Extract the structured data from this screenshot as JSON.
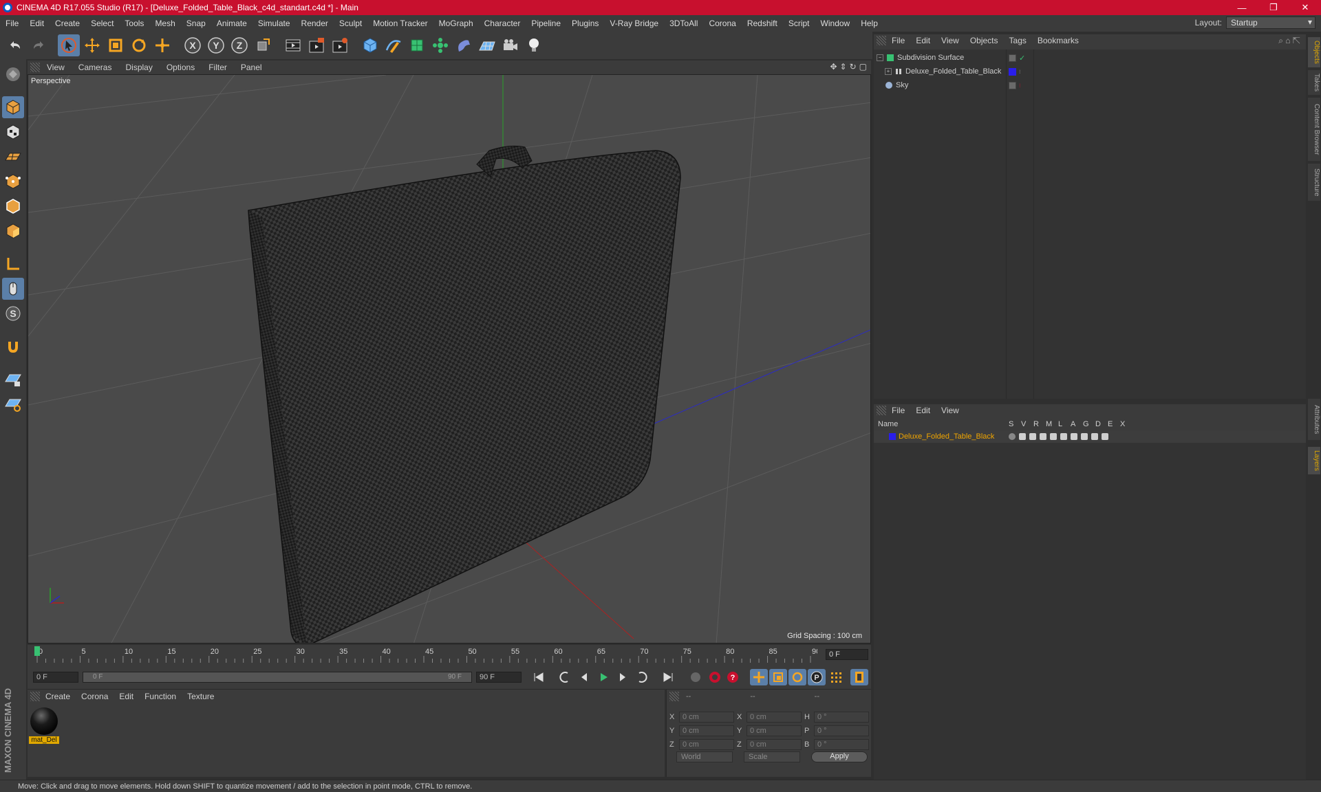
{
  "window": {
    "title": "CINEMA 4D R17.055 Studio (R17) - [Deluxe_Folded_Table_Black_c4d_standart.c4d *] - Main",
    "minimize": "—",
    "maximize": "❐",
    "close": "✕"
  },
  "menu": [
    "File",
    "Edit",
    "Create",
    "Select",
    "Tools",
    "Mesh",
    "Snap",
    "Animate",
    "Simulate",
    "Render",
    "Sculpt",
    "Motion Tracker",
    "MoGraph",
    "Character",
    "Pipeline",
    "Plugins",
    "V-Ray Bridge",
    "3DToAll",
    "Corona",
    "Redshift",
    "Script",
    "Window",
    "Help"
  ],
  "layout": {
    "label": "Layout:",
    "value": "Startup"
  },
  "toolbar": {
    "icons": [
      "undo-icon",
      "redo-icon",
      "select-arrow-icon",
      "move-icon",
      "scale-icon",
      "rotate-icon",
      "live-select-icon",
      "x-axis-icon",
      "y-axis-icon",
      "z-axis-icon",
      "coordinate-system-icon",
      "render-view-icon",
      "render-picture-viewer-icon",
      "edit-render-settings-icon",
      "cube-icon",
      "pen-spline-icon",
      "subdivision-icon",
      "array-icon",
      "deformer-icon",
      "floor-icon",
      "camera-icon",
      "light-icon"
    ]
  },
  "viewport": {
    "menu": [
      "View",
      "Cameras",
      "Display",
      "Options",
      "Filter",
      "Panel"
    ],
    "camera": "Perspective",
    "grid_spacing": "Grid Spacing : 100 cm"
  },
  "timeline": {
    "ticks": [
      "0",
      "5",
      "10",
      "15",
      "20",
      "25",
      "30",
      "35",
      "40",
      "45",
      "50",
      "55",
      "60",
      "65",
      "70",
      "75",
      "80",
      "85",
      "90"
    ],
    "current_frame": "0 F",
    "start_frame": "0 F",
    "range_start": "0 F",
    "range_end": "90 F",
    "end_frame": "90 F"
  },
  "materials": {
    "menu": [
      "Create",
      "Corona",
      "Edit",
      "Function",
      "Texture"
    ],
    "items": [
      {
        "label": "mat_Del"
      }
    ]
  },
  "coordinates": {
    "header": [
      "--",
      "--",
      "--"
    ],
    "rows": [
      {
        "a": "X",
        "v1": "0 cm",
        "b": "X",
        "v2": "0 cm",
        "c": "H",
        "v3": "0 °"
      },
      {
        "a": "Y",
        "v1": "0 cm",
        "b": "Y",
        "v2": "0 cm",
        "c": "P",
        "v3": "0 °"
      },
      {
        "a": "Z",
        "v1": "0 cm",
        "b": "Z",
        "v2": "0 cm",
        "c": "B",
        "v3": "0 °"
      }
    ],
    "world": "World",
    "scale": "Scale",
    "apply": "Apply"
  },
  "objects_panel": {
    "menu": [
      "File",
      "Edit",
      "View",
      "Objects",
      "Tags",
      "Bookmarks"
    ],
    "items": [
      {
        "name": "Subdivision Surface",
        "icon_color": "#38c172"
      },
      {
        "name": "Deluxe_Folded_Table_Black",
        "icon_color": "#cfcfcf",
        "layer_color": "#2a1eea"
      },
      {
        "name": "Sky",
        "icon_color": "#9bb4d6"
      }
    ]
  },
  "layers_panel": {
    "menu": [
      "File",
      "Edit",
      "View"
    ],
    "columns": [
      "Name",
      "S",
      "V",
      "R",
      "M",
      "L",
      "A",
      "G",
      "D",
      "E",
      "X"
    ],
    "items": [
      {
        "name": "Deluxe_Folded_Table_Black",
        "color": "#2a1eea"
      }
    ]
  },
  "side_tabs": [
    "Objects",
    "Takes",
    "Content Browser",
    "Structure",
    "Attributes",
    "Layers"
  ],
  "status": "Move: Click and drag to move elements. Hold down SHIFT to quantize movement / add to the selection in point mode, CTRL to remove.",
  "brand": "MAXON CINEMA 4D",
  "colors": {
    "accent": "#5b7fa8",
    "title_bar": "#c8102e",
    "selection": "#f0a500"
  }
}
